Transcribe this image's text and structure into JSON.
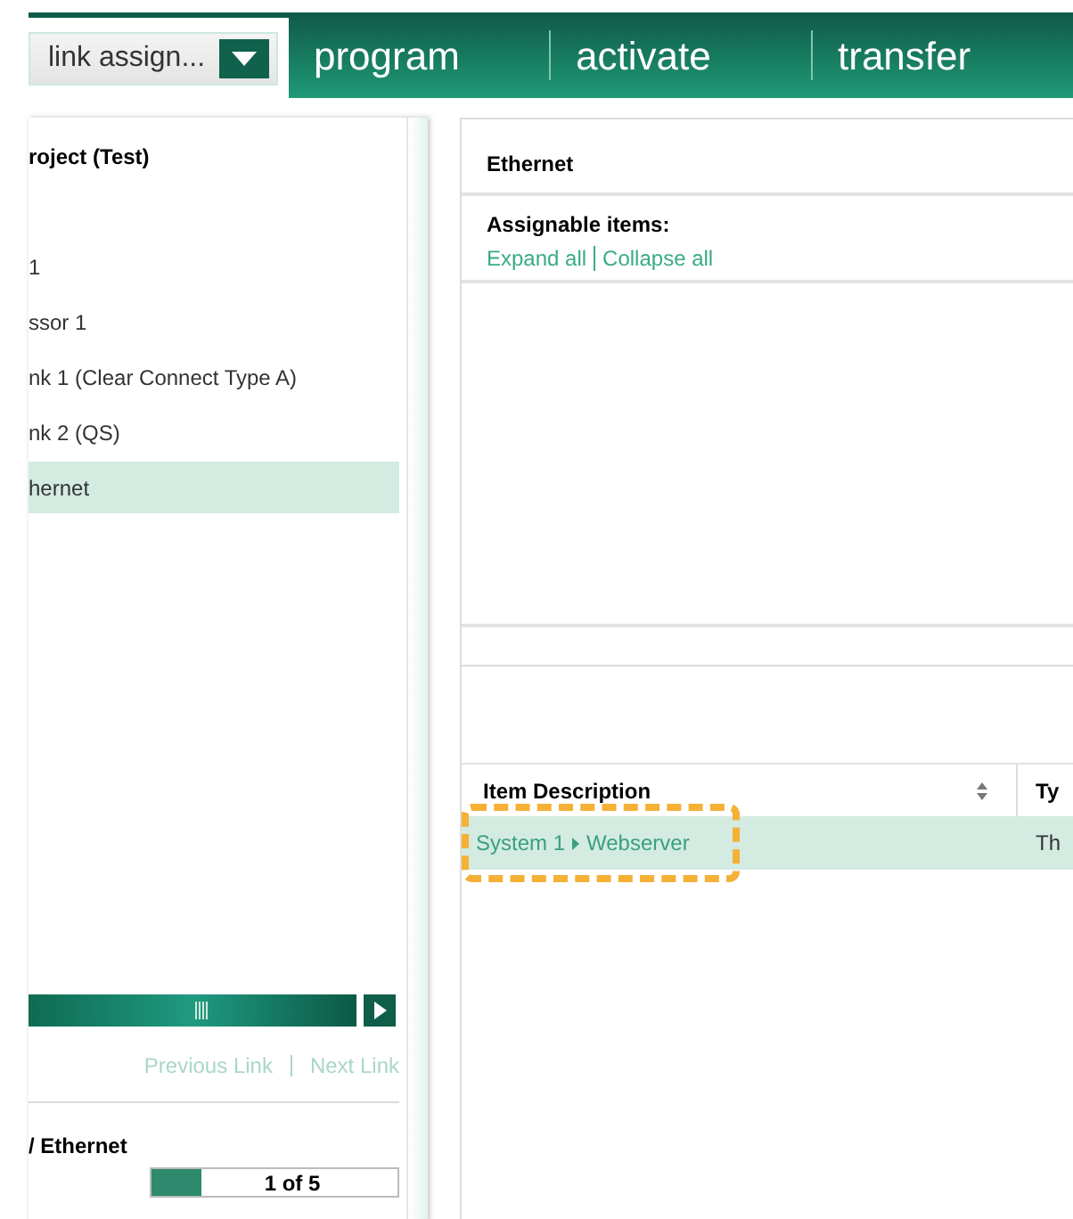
{
  "header": {
    "dropdown": "link assign...",
    "tabs": [
      {
        "label": "program",
        "selected": false
      },
      {
        "label": "activate",
        "selected": false
      },
      {
        "label": "transfer",
        "selected": false
      }
    ]
  },
  "tree": {
    "title": "roject (Test)",
    "items": [
      {
        "label": "1",
        "selected": false
      },
      {
        "label": "ssor 1",
        "selected": false
      },
      {
        "label": "nk 1 (Clear Connect Type A)",
        "selected": false
      },
      {
        "label": "nk 2 (QS)",
        "selected": false
      },
      {
        "label": "hernet",
        "selected": true
      }
    ]
  },
  "link_nav": {
    "previous": "Previous Link",
    "next": "Next Link"
  },
  "path": "/ Ethernet",
  "pager": {
    "text": "1 of 5",
    "level": 0.2
  },
  "detail": {
    "title": "Ethernet",
    "assignable_label": "Assignable items:",
    "expand": "Expand all",
    "collapse": "Collapse all"
  },
  "table": {
    "columns": [
      "Item Description",
      "Ty"
    ],
    "rows": [
      {
        "selected": true,
        "highlighted": true,
        "path": [
          "System 1",
          "Webserver"
        ],
        "column_2": "Th"
      }
    ]
  }
}
